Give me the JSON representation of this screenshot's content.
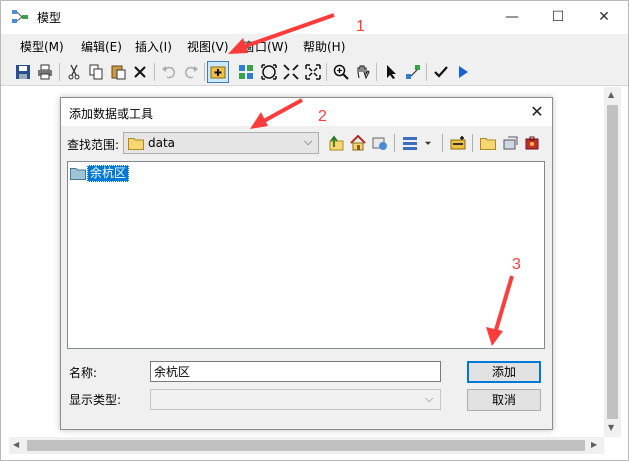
{
  "window": {
    "title": "模型",
    "controls": {
      "minimize": "—",
      "maximize": "☐",
      "close": "✕"
    }
  },
  "menubar": {
    "items": [
      "模型(M)",
      "编辑(E)",
      "插入(I)",
      "视图(V)",
      "窗口(W)",
      "帮助(H)"
    ]
  },
  "toolbar": {
    "buttons": [
      "save-icon",
      "print-icon",
      "cut-icon",
      "copy-icon",
      "paste-icon",
      "delete-icon",
      "undo-icon",
      "redo-icon",
      "add-data-icon",
      "auto-layout-icon",
      "full-extent-icon",
      "zoom-in-fixed-icon",
      "zoom-out-fixed-icon",
      "zoom-in-icon",
      "pan-icon",
      "select-icon",
      "connect-icon",
      "validate-icon",
      "run-icon"
    ]
  },
  "dialog": {
    "title": "添加数据或工具",
    "close": "✕",
    "lookin_label": "查找范围:",
    "lookin_value": "data",
    "items": [
      {
        "label": "余杭区",
        "icon": "folder-icon"
      }
    ],
    "name_label": "名称:",
    "name_value": "余杭区",
    "type_label": "显示类型:",
    "type_value": "",
    "add_label": "添加",
    "cancel_label": "取消"
  },
  "annotations": {
    "step1": "1",
    "step2": "2",
    "step3": "3",
    "color": "#ff3b3b"
  }
}
